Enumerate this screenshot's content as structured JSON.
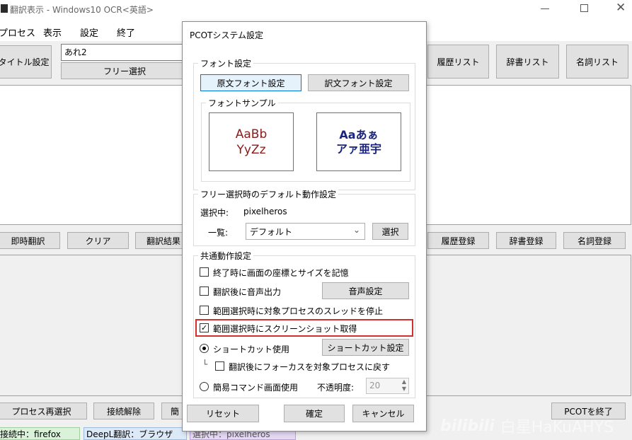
{
  "window": {
    "title": "翻訳表示 - Windows10 OCR<英語>"
  },
  "menu": [
    "プロセス",
    "表示",
    "設定",
    "終了"
  ],
  "toolbar": {
    "title_settings": "タイトル設定",
    "name_value": "あれ2",
    "free_select": "フリー選択",
    "history_list": "履歴リスト",
    "dict_list": "辞書リスト",
    "noun_list": "名詞リスト"
  },
  "midbar": {
    "instant_translate": "即時翻訳",
    "clear": "クリア",
    "translate_result": "翻訳結果",
    "history_register": "履歴登録",
    "dict_register": "辞書登録",
    "noun_register": "名詞登録"
  },
  "bottombar": {
    "reselect_process": "プロセス再選択",
    "disconnect": "接続解除",
    "simple": "簡",
    "exit_pcot": "PCOTを終了"
  },
  "status": {
    "connected": "接続中：firefox",
    "deepl": "DeepL翻訳：ブラウザ",
    "selected": "選択中：pixelheros"
  },
  "watermark": "白星HaKuAHYS",
  "dialog": {
    "title": "PCOTシステム設定",
    "font_group": {
      "title": "フォント設定",
      "source_font_button": "原文フォント設定",
      "translated_font_button": "訳文フォント設定",
      "sample_title": "フォントサンプル",
      "sample_source_line1": "AaBb",
      "sample_source_line2": "YyZz",
      "sample_translated_line1": "Ааあぁ",
      "sample_translated_line2": "アァ亜宇"
    },
    "free_select_group": {
      "title": "フリー選択時のデフォルト動作設定",
      "selected_label": "選択中:",
      "selected_value": "pixelheros",
      "list_label": "一覧:",
      "list_value": "デフォルト",
      "select_button": "選択"
    },
    "common_group": {
      "title": "共通動作設定",
      "remember_position": {
        "label": "終了時に画面の座標とサイズを記憶",
        "checked": false
      },
      "voice_output": {
        "label": "翻訳後に音声出力",
        "checked": false
      },
      "voice_settings_button": "音声設定",
      "stop_thread": {
        "label": "範囲選択時に対象プロセスのスレッドを停止",
        "checked": false
      },
      "screenshot": {
        "label": "範囲選択時にスクリーンショット取得",
        "checked": true
      },
      "shortcut_radio": {
        "label": "ショートカット使用",
        "selected": true
      },
      "shortcut_settings_button": "ショートカット設定",
      "return_focus": {
        "label": "翻訳後にフォーカスを対象プロセスに戻す",
        "checked": false
      },
      "simple_cmd_radio": {
        "label": "簡易コマンド画面使用",
        "selected": false
      },
      "opacity_label": "不透明度:",
      "opacity_value": "20"
    },
    "reset_button": "リセット",
    "ok_button": "確定",
    "cancel_button": "キャンセル"
  },
  "colors": {
    "highlight_border": "#d32f2f",
    "sample_source_color": "#8b1a1a",
    "sample_translated_color": "#1a237e",
    "status_connected_bg": "#d9f2d9",
    "status_deepl_bg": "#dce9f7",
    "status_selected_bg": "#e6d9f5"
  }
}
